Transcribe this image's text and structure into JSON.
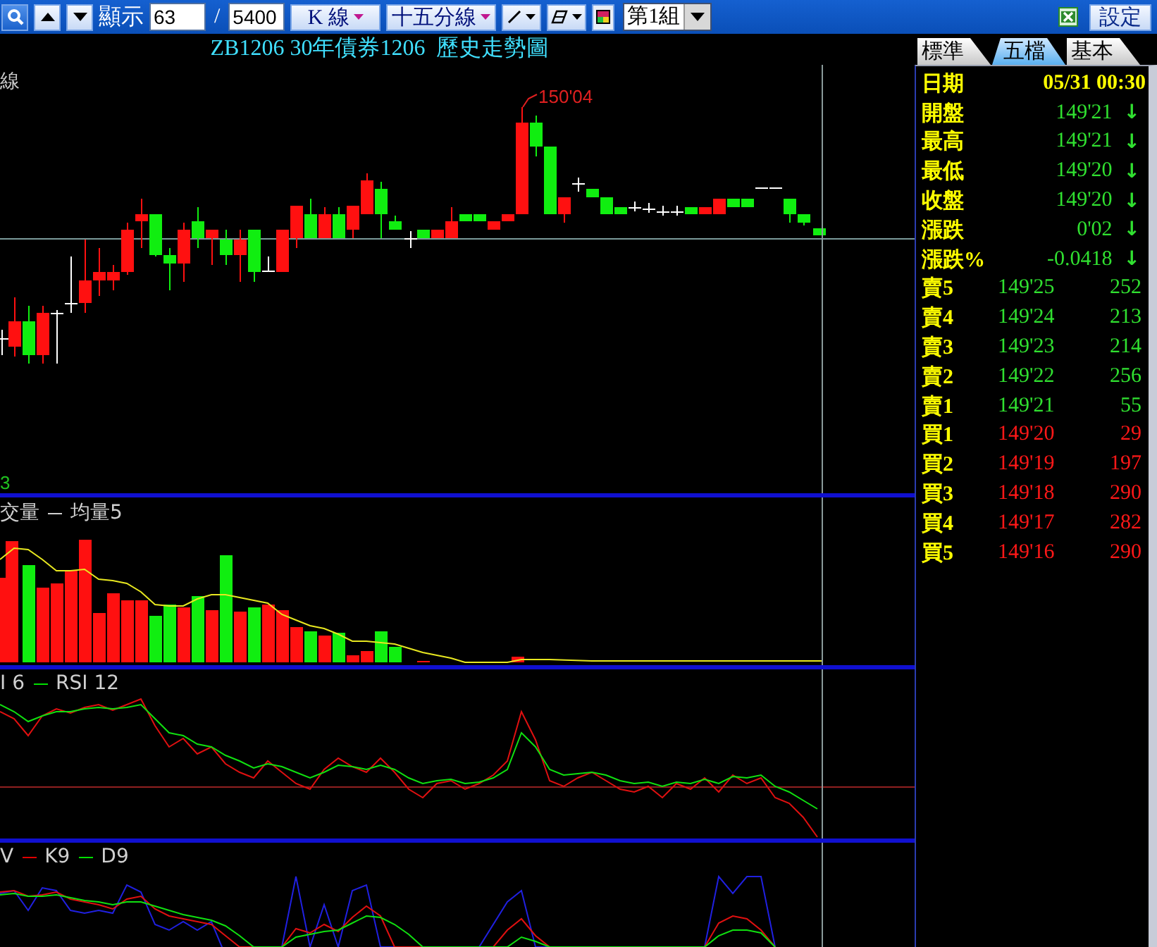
{
  "toolbar": {
    "display_label": "顯示",
    "start_field": "63",
    "separator": "/",
    "count_field": "5400",
    "chart_type": "K 線",
    "interval": "十五分線",
    "group": "第1組",
    "settings": "設定"
  },
  "chart_title": "ZB1206 30年債券1206  歷史走勢圖",
  "price_panel": {
    "label": "線",
    "peak_label": "150'04",
    "bottom_label": "3"
  },
  "volume_panel": {
    "legend": [
      {
        "label": "交量"
      },
      {
        "label": "均量5",
        "color": "#d0d0d0"
      }
    ]
  },
  "rsi_panel": {
    "legend": [
      {
        "label": "I 6"
      },
      {
        "label": "RSI 12",
        "color": "#00e000"
      }
    ]
  },
  "kd_panel": {
    "legend": [
      {
        "label": "V"
      },
      {
        "label": "K9",
        "color": "#e00000"
      },
      {
        "label": "D9",
        "color": "#00e000"
      }
    ]
  },
  "tabs": [
    {
      "label": "標準",
      "selected": false
    },
    {
      "label": "五檔",
      "selected": true
    },
    {
      "label": "基本",
      "selected": false
    }
  ],
  "quote": {
    "date_label": "日期",
    "date_value": "05/31 00:30",
    "stats": [
      {
        "label": "開盤",
        "value": "149'21",
        "arrow": "↓"
      },
      {
        "label": "最高",
        "value": "149'21",
        "arrow": "↓"
      },
      {
        "label": "最低",
        "value": "149'20",
        "arrow": "↓"
      },
      {
        "label": "收盤",
        "value": "149'20",
        "arrow": "↓"
      },
      {
        "label": "漲跌",
        "value": "0'02",
        "arrow": "↓"
      },
      {
        "label": "漲跌%",
        "value": "-0.0418",
        "arrow": "↓"
      }
    ],
    "depth": [
      {
        "label": "賣5",
        "price": "149'25",
        "volume": "252",
        "kind": "sell"
      },
      {
        "label": "賣4",
        "price": "149'24",
        "volume": "213",
        "kind": "sell"
      },
      {
        "label": "賣3",
        "price": "149'23",
        "volume": "214",
        "kind": "sell"
      },
      {
        "label": "賣2",
        "price": "149'22",
        "volume": "256",
        "kind": "sell"
      },
      {
        "label": "賣1",
        "price": "149'21",
        "volume": "55",
        "kind": "sell"
      },
      {
        "label": "買1",
        "price": "149'20",
        "volume": "29",
        "kind": "buy"
      },
      {
        "label": "買2",
        "price": "149'19",
        "volume": "197",
        "kind": "buy"
      },
      {
        "label": "買3",
        "price": "149'18",
        "volume": "290",
        "kind": "buy"
      },
      {
        "label": "買4",
        "price": "149'17",
        "volume": "282",
        "kind": "buy"
      },
      {
        "label": "買5",
        "price": "149'16",
        "volume": "290",
        "kind": "buy"
      }
    ]
  }
}
